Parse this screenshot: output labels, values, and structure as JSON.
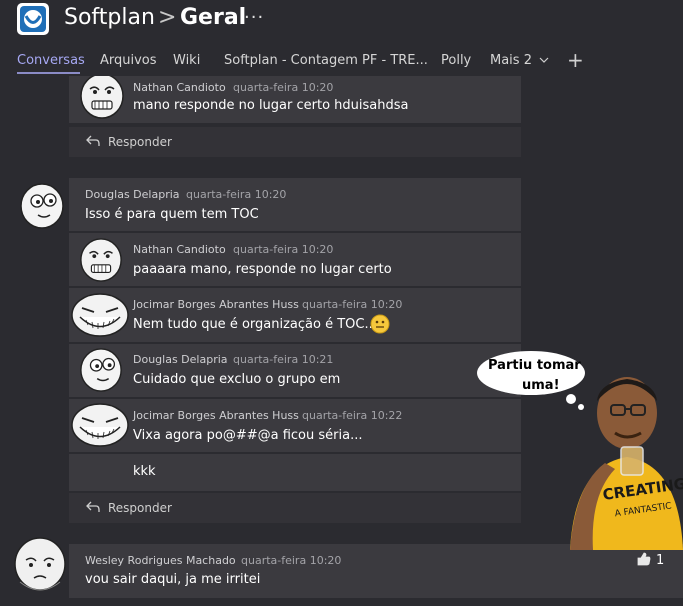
{
  "header": {
    "team_name": "Softplan",
    "separator": ">",
    "channel_name": "Geral",
    "more_options": "···"
  },
  "tabs": [
    {
      "label": "Conversas",
      "active": true
    },
    {
      "label": "Arquivos"
    },
    {
      "label": "Wiki"
    },
    {
      "label": "Softplan - Contagem PF - TRE..."
    },
    {
      "label": "Polly"
    },
    {
      "label": "Mais 2"
    }
  ],
  "add_tab_label": "+",
  "thread1": {
    "messages": [
      {
        "author": "Nathan Candioto",
        "time": "quarta-feira 10:20",
        "text": "mano responde no lugar certo hduisahdsa"
      }
    ],
    "reply_label": "Responder"
  },
  "thread2": {
    "messages": [
      {
        "author": "Douglas Delapria",
        "time": "quarta-feira 10:20",
        "text": "Isso é para quem tem TOC"
      },
      {
        "author": "Nathan Candioto",
        "time": "quarta-feira 10:20",
        "text": "paaaara mano, responde no lugar certo"
      },
      {
        "author": "Jocimar Borges Abrantes Huss",
        "time": "quarta-feira 10:20",
        "text": "Nem tudo que é organização é TOC...."
      },
      {
        "author": "Douglas Delapria",
        "time": "quarta-feira 10:21",
        "text": "Cuidado que excluo o grupo em"
      },
      {
        "author": "Jocimar Borges Abrantes Huss",
        "time": "quarta-feira 10:22",
        "text": "Vixa agora po@##@a ficou séria..."
      },
      {
        "author": "",
        "time": "",
        "text": "kkk"
      }
    ],
    "reply_label": "Responder"
  },
  "thread3": {
    "messages": [
      {
        "author": "Wesley Rodrigues Machado",
        "time": "quarta-feira 10:20",
        "text": "vou sair daqui, ja me irritei",
        "likes": "1"
      }
    ]
  },
  "sticker": {
    "bubble_line1": "Partiu tomar",
    "bubble_line2": "uma!",
    "shirt_text": "CREATING A FANTASTIC WORLD OF BOYS"
  },
  "colors": {
    "background": "#2b2b30",
    "card": "#3b3a3f",
    "accent": "#a6a8f3"
  },
  "icons": [
    "team-logo-icon",
    "reply-arrow-icon",
    "like-icon",
    "chevron-down-icon",
    "plus-icon",
    "slightly-smiling-emoji-icon"
  ]
}
